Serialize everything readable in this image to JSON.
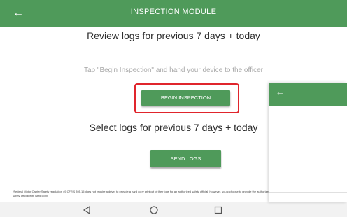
{
  "header": {
    "back_icon": "arrow-left-icon",
    "title": "INSPECTION MODULE"
  },
  "review": {
    "heading": "Review logs for previous 7 days + today",
    "hint": "Tap \"Begin Inspection\" and hand your device to the officer",
    "button_label": "BEGIN INSPECTION"
  },
  "select": {
    "heading": "Select logs for previous 7 days + today",
    "button_label": "SEND LOGS"
  },
  "footnote": "*Federal Motor Carrier Safety regulation 49 CFR § 395.15 does not require a driver to provide a hard copy printout of their logs for an authorized safety official. However, you c choose to provide the authorized safety official with hard copy.",
  "navbar": {
    "icons": [
      "triangle-back-icon",
      "circle-home-icon",
      "square-recents-icon"
    ]
  },
  "overlay": {
    "back_icon": "arrow-left-icon"
  },
  "colors": {
    "accent": "#4f9a5a",
    "highlight": "#e0252c"
  }
}
